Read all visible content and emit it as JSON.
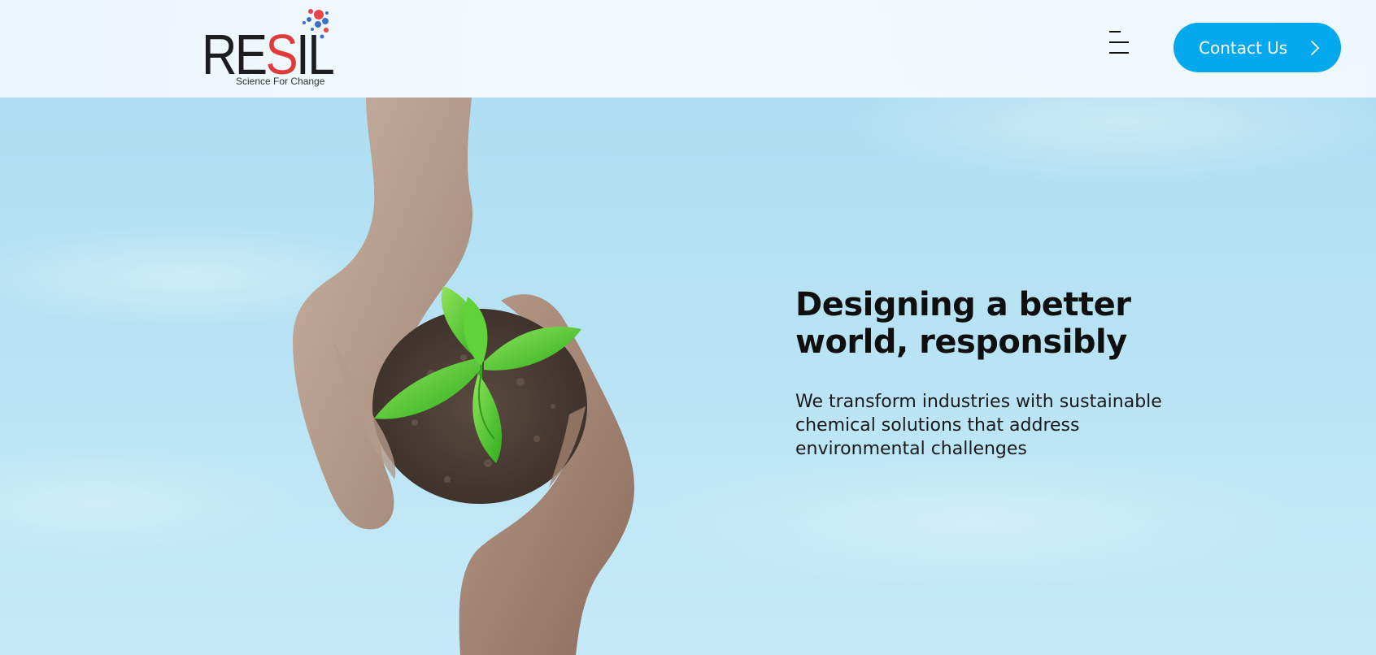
{
  "brand": {
    "name_prefix": "RE",
    "name_accent": "S",
    "name_suffix": "IL",
    "tagline": "Science For Change",
    "accent_color": "#e03b3b",
    "text_color": "#1d1d1f"
  },
  "header": {
    "menu_icon": "hamburger-menu-icon",
    "contact_button": {
      "label": "Contact Us",
      "icon": "chevron-right-icon",
      "color": "#03a9ec"
    }
  },
  "hero": {
    "title": "Designing a better world, responsibly",
    "subtitle": "We transform industries with sustainable chemical solutions that address environmental challenges",
    "image": "hands-holding-seedling-illustration",
    "background_color": "#b6e2f4"
  }
}
